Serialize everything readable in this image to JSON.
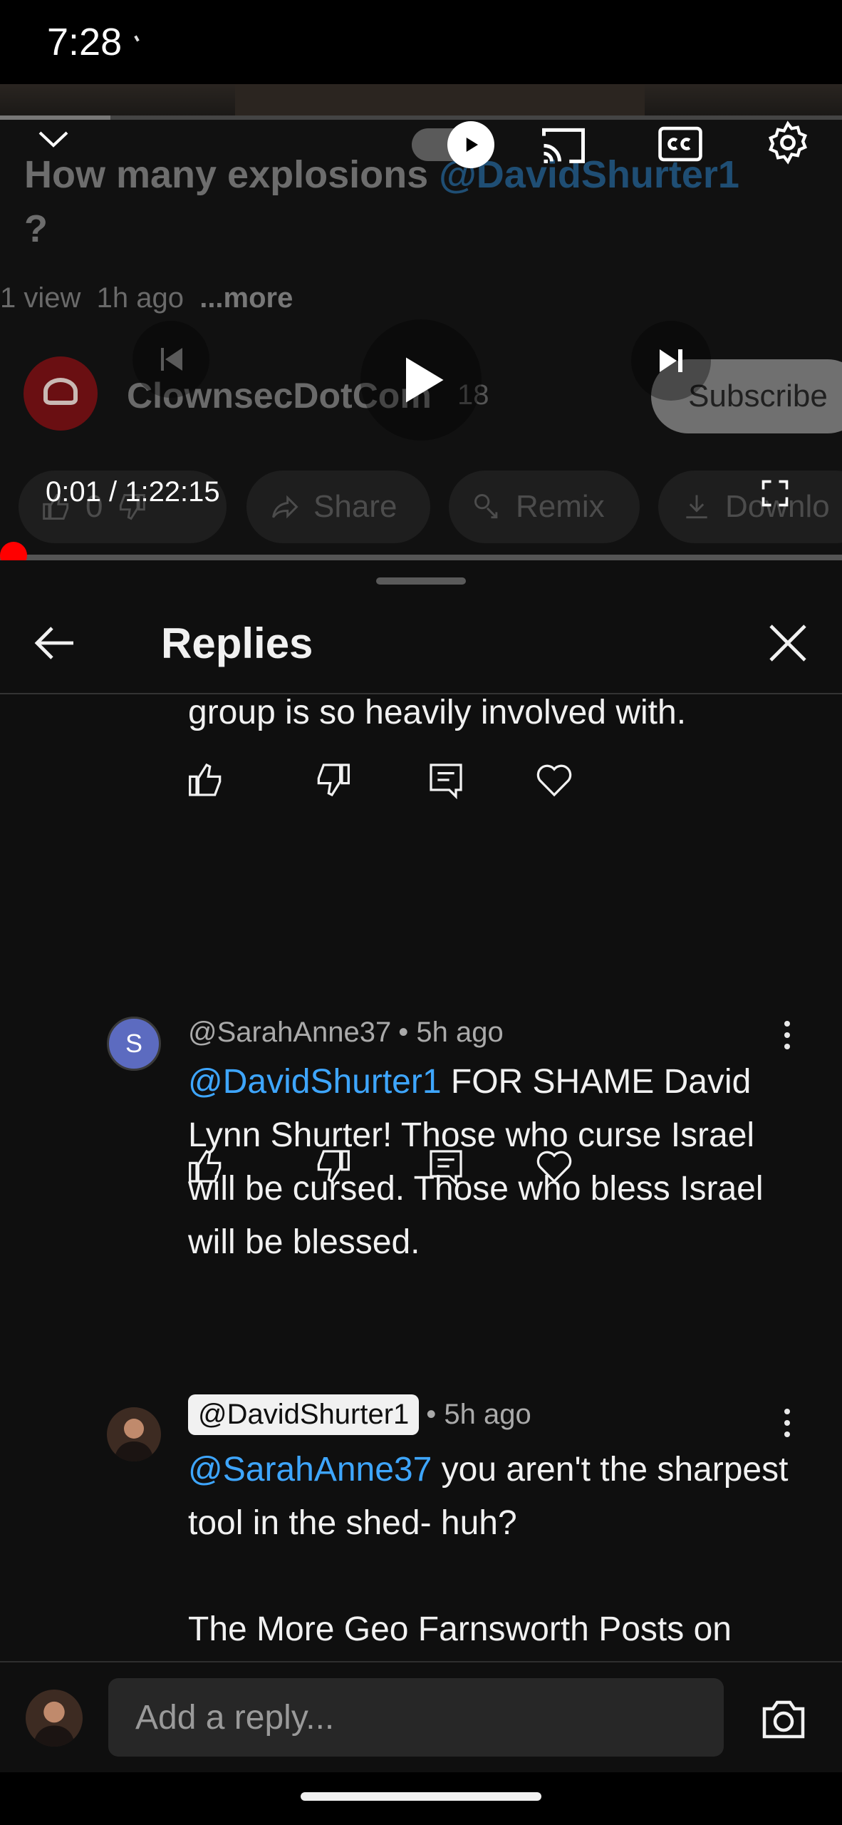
{
  "status_bar": {
    "time": "7:28"
  },
  "video": {
    "title_prefix": "How many explosions ",
    "title_mention": "@DavidShurter1",
    "title_suffix": "?",
    "meta_views": "1 view",
    "meta_age": "1h ago",
    "meta_more": "...more",
    "channel_name": "ClownsecDotCom",
    "channel_subs": "18",
    "subscribe_label": "Subscribe",
    "like_count": "0",
    "share_label": "Share",
    "remix_label": "Remix",
    "download_label": "Downlo",
    "current_time": "0:01",
    "duration": "1:22:15",
    "time_separator": " / ",
    "progress_fraction": 0.0002
  },
  "sheet": {
    "title": "Replies",
    "partial_text": "group is so heavily involved with."
  },
  "comments": [
    {
      "avatar_letter": "S",
      "avatar_color": "#5c6bc0",
      "handle": "@SarahAnne37",
      "age": " • 5h ago",
      "mention": "@DavidShurter1",
      "body": "   FOR SHAME David Lynn Shurter! Those who curse Israel will be cursed. Those who bless Israel will be blessed."
    },
    {
      "handle": "@DavidShurter1",
      "age": " • 5h ago",
      "mention": "@SarahAnne37",
      "body": " you aren't the sharpest tool in the shed- huh?",
      "body_p2": "The More Geo Farnsworth Posts on YouTube the More Resolute I Am in Believing He with Daniel Doud Murdered My Friend Owen"
    }
  ],
  "composer": {
    "placeholder": "Add a reply..."
  },
  "colors": {
    "accent": "#3ea6ff",
    "progress": "#ff0000",
    "background": "#0f0f0f"
  }
}
